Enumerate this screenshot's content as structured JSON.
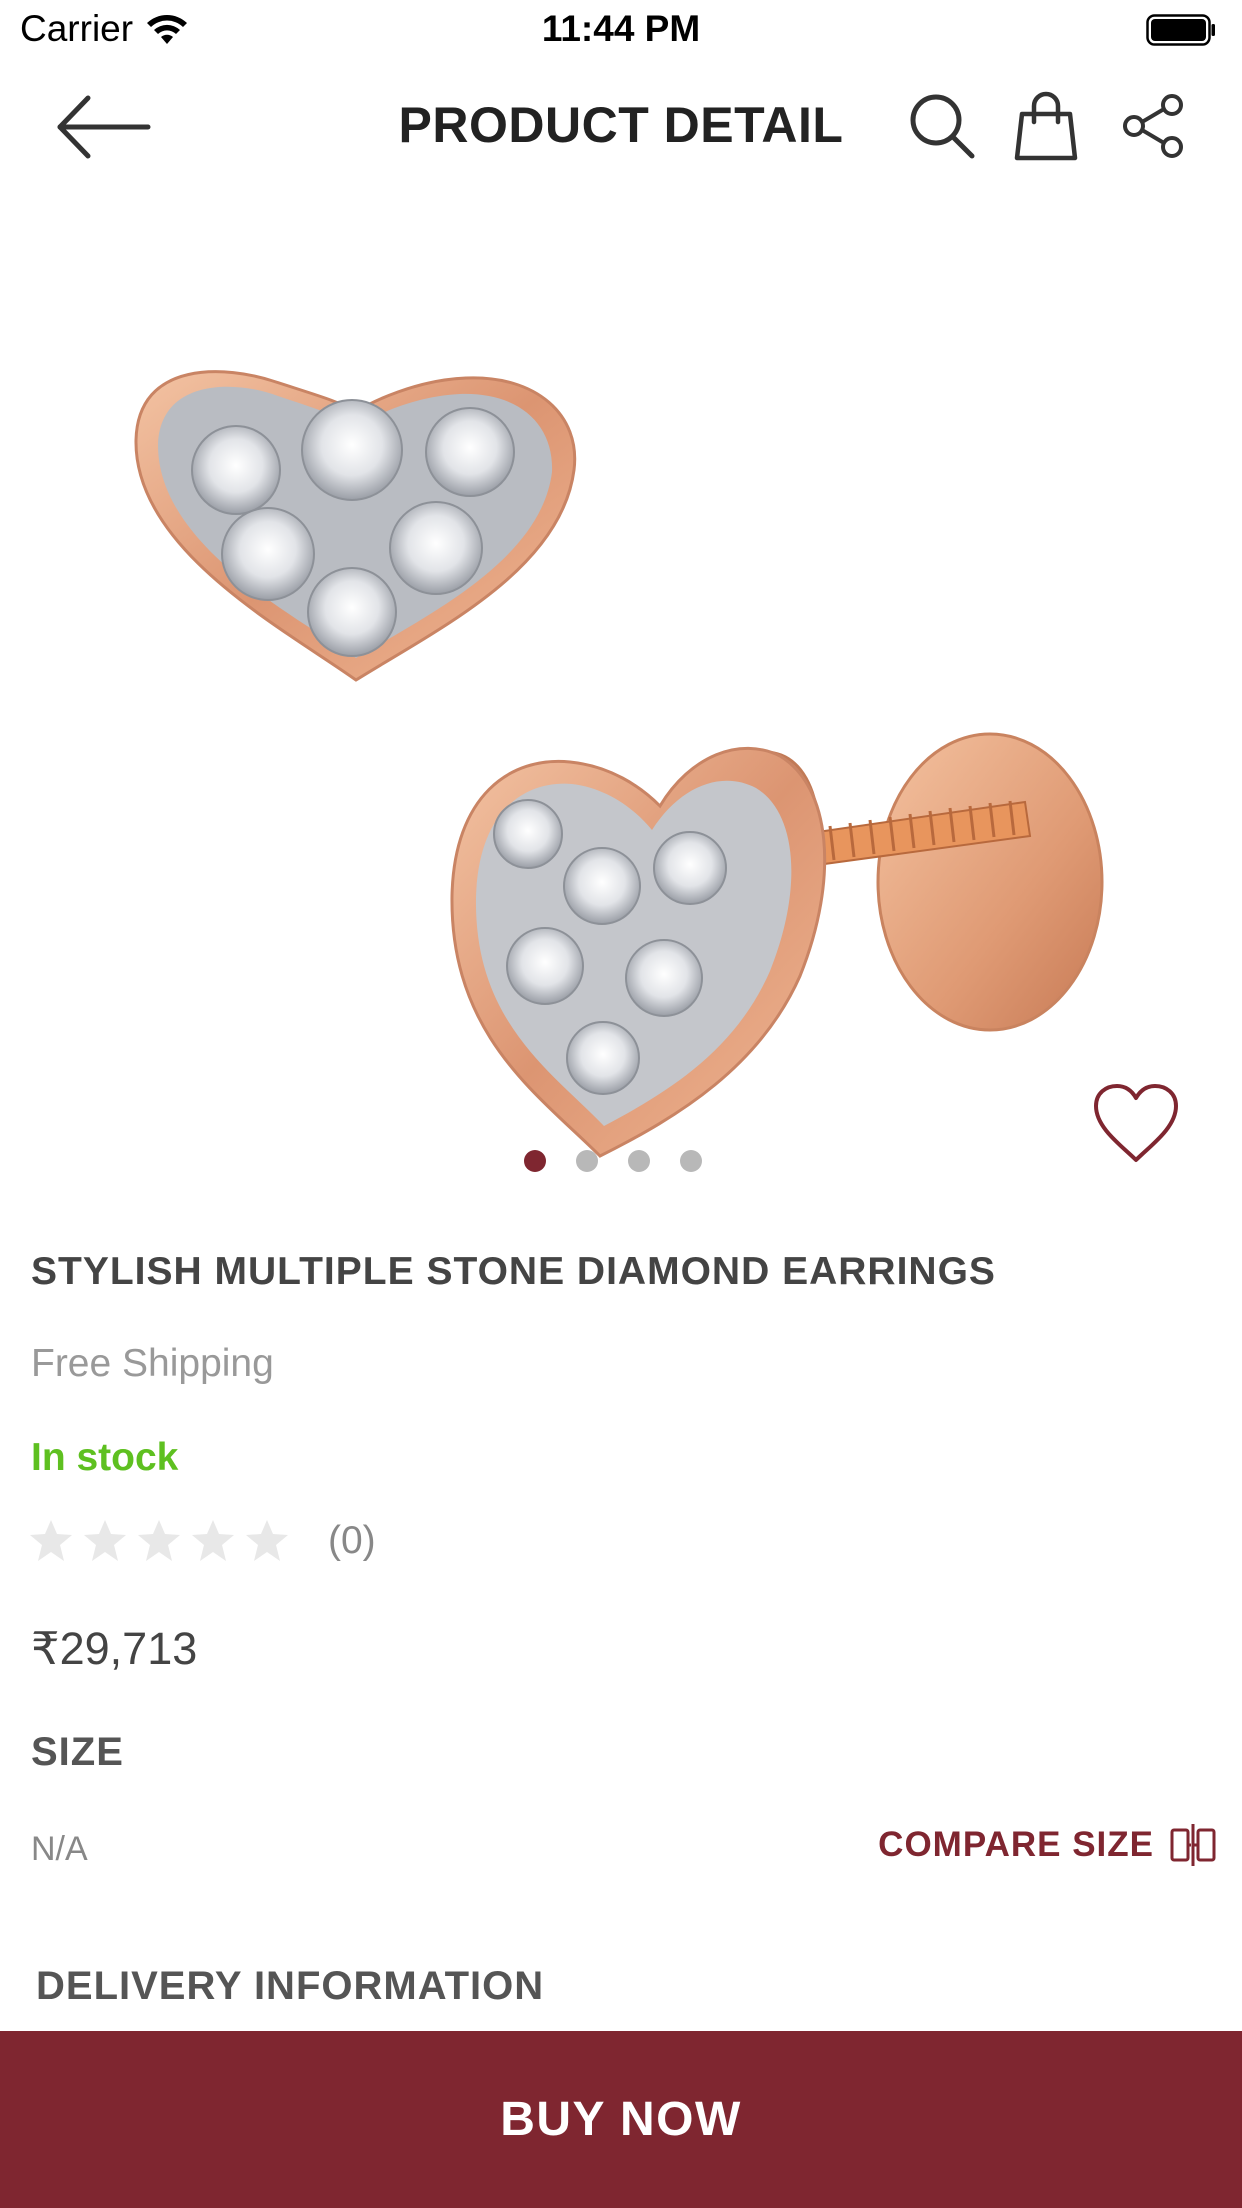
{
  "status_bar": {
    "carrier": "Carrier",
    "time": "11:44 PM",
    "wifi_icon": "wifi-icon",
    "battery_icon": "battery-icon"
  },
  "nav": {
    "title": "PRODUCT DETAIL",
    "back_icon": "back-arrow-icon",
    "search_icon": "search-icon",
    "bag_icon": "shopping-bag-icon",
    "share_icon": "share-icon"
  },
  "carousel": {
    "image_description": "rose gold heart-shaped diamond stud earrings",
    "page_count": 4,
    "active_index": 0,
    "wishlist_icon": "heart-outline-icon"
  },
  "product": {
    "name": "STYLISH MULTIPLE STONE DIAMOND EARRINGS",
    "shipping": "Free Shipping",
    "stock": "In stock",
    "rating_stars": 0,
    "rating_max": 5,
    "rating_count": "(0)",
    "price": "₹29,713"
  },
  "size": {
    "heading": "SIZE",
    "value": "N/A",
    "compare_label": "COMPARE SIZE",
    "compare_icon": "compare-size-icon"
  },
  "delivery": {
    "heading": "DELIVERY INFORMATION"
  },
  "cta": {
    "buy_now_label": "BUY NOW"
  },
  "colors": {
    "brand": "#7f2630",
    "in_stock": "#5ec020",
    "muted_text": "#999999",
    "rose_gold": "#e0a080"
  }
}
